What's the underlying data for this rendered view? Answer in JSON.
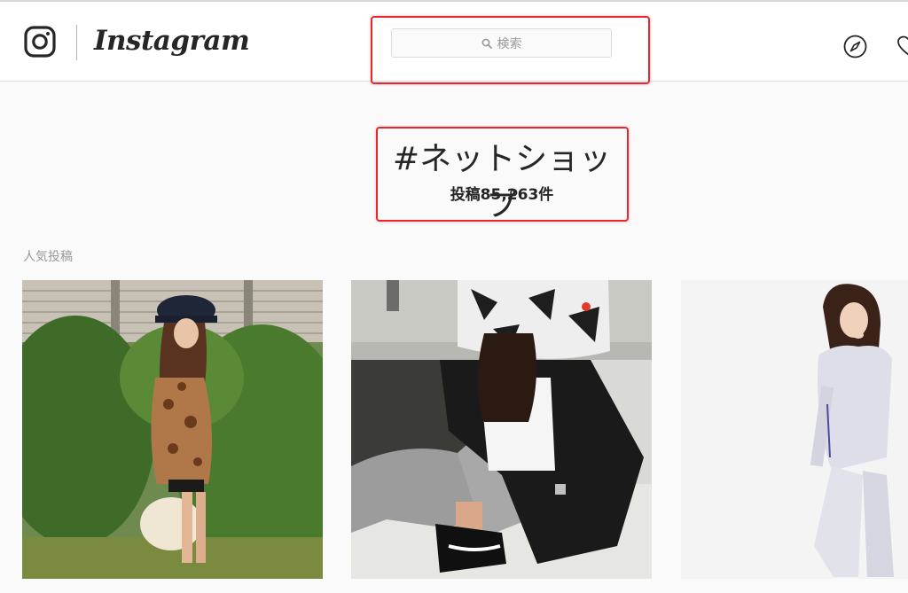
{
  "brand": {
    "wordmark": "Instagram"
  },
  "search": {
    "placeholder": "検索"
  },
  "hashtag_page": {
    "title": "#ネットショップ",
    "post_count": "投稿85,263件"
  },
  "sections": {
    "top_posts_label": "人気投稿"
  },
  "icons": {
    "logo": "instagram-camera-icon",
    "search": "search-icon",
    "explore": "compass-icon",
    "activity": "heart-icon"
  },
  "annotation_color": "#e8262d",
  "posts": [
    {
      "description": "woman in navy cap and leopard sweater by hedge",
      "image_name": "post-photo-1"
    },
    {
      "description": "person in black jacket and print hood sitting",
      "image_name": "post-photo-2"
    },
    {
      "description": "girl in white tracksuit on white background",
      "image_name": "post-photo-3"
    }
  ]
}
